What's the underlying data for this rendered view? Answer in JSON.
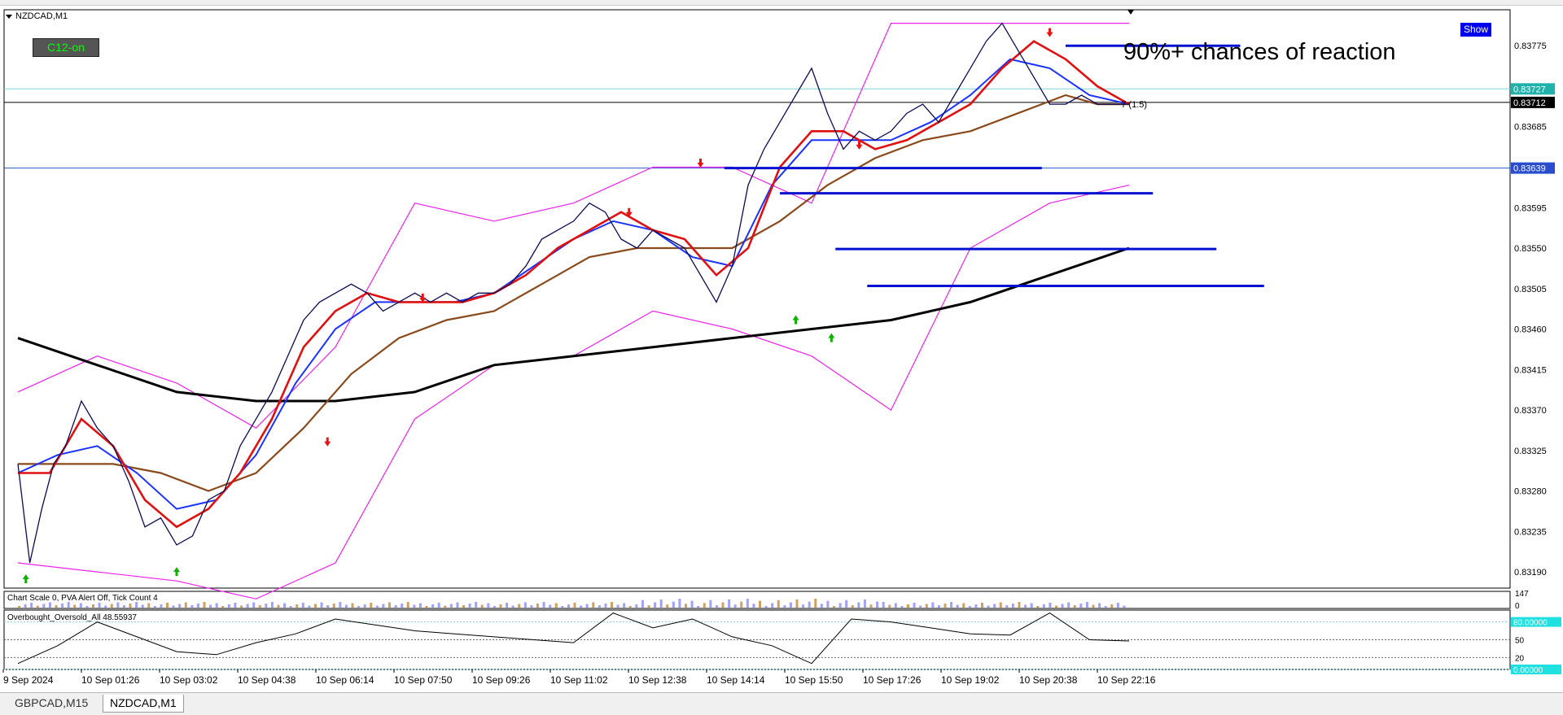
{
  "window": {
    "symbol_title": "NZDCAD,M1",
    "indicator_button": "C12-on",
    "show_button": "Show",
    "annotation": "90%+ chances of reaction",
    "info_line": "Chart Scale  0,   PVA Alert Off,   Tick Count  4",
    "oscillator_label": "Overbought_Oversold_All 48.55937",
    "ratio_label": "7 (1.5)"
  },
  "tabs": [
    {
      "label": "GBPCAD,M15",
      "active": false
    },
    {
      "label": "NZDCAD,M1",
      "active": true
    }
  ],
  "colors": {
    "price": "#0b0b55",
    "ma_red": "#e01010",
    "ma_blue": "#1a33ff",
    "ma_brown": "#8b4a1c",
    "ma_black": "#000000",
    "envelope_pink": "#ee22ee",
    "bands_gray": "#222222",
    "levels_blue": "#0010d0",
    "grid_cyan": "#7fd6d6",
    "tag_cyan": "#20b2aa",
    "signal_green": "#10b000",
    "signal_red": "#ee1111"
  },
  "chart_data": {
    "type": "line",
    "title": "NZDCAD,M1",
    "x_ticks": [
      "9 Sep 2024",
      "10 Sep 01:26",
      "10 Sep 03:02",
      "10 Sep 04:38",
      "10 Sep 06:14",
      "10 Sep 07:50",
      "10 Sep 09:26",
      "10 Sep 11:02",
      "10 Sep 12:38",
      "10 Sep 14:14",
      "10 Sep 15:50",
      "10 Sep 17:26",
      "10 Sep 19:02",
      "10 Sep 20:38",
      "10 Sep 22:16"
    ],
    "y_ticks": [
      0.83775,
      0.83685,
      0.83595,
      0.8355,
      0.83505,
      0.8346,
      0.83415,
      0.8337,
      0.83325,
      0.8328,
      0.83235,
      0.8319
    ],
    "y_tick_labels": [
      "0.83775",
      "0.83685",
      "0.83595",
      "0.83550",
      "0.83505",
      "0.83460",
      "0.83415",
      "0.83370",
      "0.83325",
      "0.83280",
      "0.83235",
      "0.83190"
    ],
    "ylim": [
      0.83172,
      0.83815
    ],
    "xlim": [
      0,
      14
    ],
    "price_tags": [
      {
        "label": "0.83727",
        "value": 0.83727,
        "style": "cyan"
      },
      {
        "label": "0.83712",
        "value": 0.83712,
        "style": "black"
      },
      {
        "label": "0.83639",
        "value": 0.83639,
        "style": "blue"
      }
    ],
    "levels": [
      {
        "x1": 13.2,
        "x2": 15.4,
        "value": 0.83775
      },
      {
        "x1": 8.9,
        "x2": 12.9,
        "value": 0.83639
      },
      {
        "x1": 9.6,
        "x2": 14.3,
        "value": 0.83611
      },
      {
        "x1": 10.3,
        "x2": 15.1,
        "value": 0.83549
      },
      {
        "x1": 10.7,
        "x2": 15.7,
        "value": 0.83508
      }
    ],
    "series": [
      {
        "role": "price",
        "x": [
          0,
          0.15,
          0.3,
          0.45,
          0.6,
          0.8,
          1.0,
          1.2,
          1.4,
          1.6,
          1.8,
          2.0,
          2.2,
          2.4,
          2.6,
          2.8,
          3.0,
          3.2,
          3.4,
          3.6,
          3.8,
          4.0,
          4.2,
          4.4,
          4.6,
          4.8,
          5.0,
          5.2,
          5.4,
          5.6,
          5.8,
          6.0,
          6.2,
          6.4,
          6.6,
          6.8,
          7.0,
          7.2,
          7.4,
          7.6,
          7.8,
          8.0,
          8.2,
          8.4,
          8.6,
          8.8,
          9.0,
          9.2,
          9.4,
          9.6,
          9.8,
          10.0,
          10.2,
          10.4,
          10.6,
          10.8,
          11.0,
          11.2,
          11.4,
          11.6,
          11.8,
          12.0,
          12.2,
          12.4,
          12.6,
          12.8,
          13.0,
          13.2,
          13.4,
          13.6,
          13.8,
          14.0
        ],
        "values": [
          0.8331,
          0.832,
          0.8326,
          0.8331,
          0.8333,
          0.8338,
          0.8335,
          0.8333,
          0.8329,
          0.8324,
          0.8325,
          0.8322,
          0.8323,
          0.8327,
          0.8328,
          0.8333,
          0.8336,
          0.8339,
          0.8343,
          0.8347,
          0.8349,
          0.835,
          0.8351,
          0.835,
          0.8348,
          0.8349,
          0.835,
          0.8349,
          0.835,
          0.8349,
          0.835,
          0.835,
          0.8351,
          0.8353,
          0.8356,
          0.8357,
          0.8358,
          0.836,
          0.8359,
          0.8356,
          0.8355,
          0.8357,
          0.8356,
          0.8355,
          0.8352,
          0.8349,
          0.8353,
          0.8362,
          0.8366,
          0.8369,
          0.8372,
          0.8375,
          0.837,
          0.8366,
          0.8368,
          0.8367,
          0.8368,
          0.837,
          0.8371,
          0.8369,
          0.8372,
          0.8375,
          0.8378,
          0.838,
          0.8377,
          0.8374,
          0.8371,
          0.8371,
          0.8372,
          0.8371,
          0.8371,
          0.8371
        ]
      },
      {
        "role": "ma-red",
        "x": [
          0,
          0.4,
          0.8,
          1.2,
          1.6,
          2.0,
          2.4,
          2.8,
          3.2,
          3.6,
          4.0,
          4.4,
          4.8,
          5.2,
          5.6,
          6.0,
          6.4,
          6.8,
          7.2,
          7.6,
          8.0,
          8.4,
          8.8,
          9.2,
          9.6,
          10.0,
          10.4,
          10.8,
          11.2,
          11.6,
          12.0,
          12.4,
          12.8,
          13.2,
          13.6,
          14.0
        ],
        "values": [
          0.833,
          0.833,
          0.8336,
          0.8333,
          0.8327,
          0.8324,
          0.8326,
          0.833,
          0.8336,
          0.8344,
          0.8348,
          0.835,
          0.8349,
          0.8349,
          0.8349,
          0.835,
          0.8352,
          0.8355,
          0.8357,
          0.8359,
          0.8357,
          0.8356,
          0.8352,
          0.8355,
          0.8364,
          0.8368,
          0.8368,
          0.8366,
          0.8367,
          0.8369,
          0.8371,
          0.8375,
          0.8378,
          0.8376,
          0.8373,
          0.8371
        ]
      },
      {
        "role": "ma-blue",
        "x": [
          0,
          0.5,
          1.0,
          1.5,
          2.0,
          2.5,
          3.0,
          3.5,
          4.0,
          4.5,
          5.0,
          5.5,
          6.0,
          6.5,
          7.0,
          7.5,
          8.0,
          8.5,
          9.0,
          9.5,
          10.0,
          10.5,
          11.0,
          11.5,
          12.0,
          12.5,
          13.0,
          13.5,
          14.0
        ],
        "values": [
          0.833,
          0.8332,
          0.8333,
          0.833,
          0.8326,
          0.8327,
          0.8332,
          0.834,
          0.8346,
          0.8349,
          0.8349,
          0.8349,
          0.835,
          0.8353,
          0.8356,
          0.8358,
          0.8357,
          0.8354,
          0.8353,
          0.8362,
          0.8367,
          0.8367,
          0.8367,
          0.8369,
          0.8372,
          0.8376,
          0.8375,
          0.8372,
          0.8371
        ]
      },
      {
        "role": "ma-brown",
        "x": [
          0,
          0.6,
          1.2,
          1.8,
          2.4,
          3.0,
          3.6,
          4.2,
          4.8,
          5.4,
          6.0,
          6.6,
          7.2,
          7.8,
          8.4,
          9.0,
          9.6,
          10.2,
          10.8,
          11.4,
          12.0,
          12.6,
          13.2,
          13.6,
          14.0
        ],
        "values": [
          0.8331,
          0.8331,
          0.8331,
          0.833,
          0.8328,
          0.833,
          0.8335,
          0.8341,
          0.8345,
          0.8347,
          0.8348,
          0.8351,
          0.8354,
          0.8355,
          0.8355,
          0.8355,
          0.8358,
          0.8362,
          0.8365,
          0.8367,
          0.8368,
          0.837,
          0.8372,
          0.8371,
          0.8371
        ]
      },
      {
        "role": "ma-black",
        "x": [
          0,
          1,
          2,
          3,
          4,
          5,
          6,
          7,
          8,
          9,
          10,
          11,
          12,
          13,
          14
        ],
        "values": [
          0.8345,
          0.8342,
          0.8339,
          0.8338,
          0.8338,
          0.8339,
          0.8342,
          0.8343,
          0.8344,
          0.8345,
          0.8346,
          0.8347,
          0.8349,
          0.8352,
          0.8355
        ]
      },
      {
        "role": "band-pink-upper",
        "x": [
          0,
          1,
          2,
          3,
          4,
          5,
          6,
          7,
          8,
          9,
          10,
          11,
          12,
          13,
          14
        ],
        "values": [
          0.8339,
          0.8343,
          0.834,
          0.8335,
          0.8344,
          0.836,
          0.8358,
          0.836,
          0.8364,
          0.8364,
          0.836,
          0.838,
          0.838,
          0.838,
          0.838
        ]
      },
      {
        "role": "band-pink-lower",
        "x": [
          0,
          1,
          2,
          3,
          4,
          5,
          6,
          7,
          8,
          9,
          10,
          11,
          12,
          13,
          14
        ],
        "values": [
          0.832,
          0.8319,
          0.8318,
          0.8316,
          0.832,
          0.8336,
          0.8342,
          0.8343,
          0.8348,
          0.8346,
          0.8343,
          0.8337,
          0.8355,
          0.836,
          0.8362
        ]
      }
    ],
    "signals": [
      {
        "x": 0.1,
        "value": 0.83182,
        "dir": "up"
      },
      {
        "x": 2.0,
        "value": 0.8319,
        "dir": "up"
      },
      {
        "x": 9.8,
        "value": 0.8347,
        "dir": "up"
      },
      {
        "x": 10.25,
        "value": 0.8345,
        "dir": "up"
      },
      {
        "x": 3.9,
        "value": 0.83335,
        "dir": "down"
      },
      {
        "x": 5.1,
        "value": 0.83495,
        "dir": "down"
      },
      {
        "x": 7.7,
        "value": 0.8359,
        "dir": "down"
      },
      {
        "x": 8.6,
        "value": 0.83645,
        "dir": "down"
      },
      {
        "x": 10.6,
        "value": 0.83665,
        "dir": "down"
      },
      {
        "x": 13.0,
        "value": 0.8379,
        "dir": "down"
      }
    ],
    "volume": {
      "label_top": "147",
      "label_bottom": "0",
      "ylim": [
        0,
        147
      ]
    },
    "oscillator": {
      "ylim": [
        0,
        100
      ],
      "level_labels": [
        "80.00000",
        "50",
        "20",
        "0.00000"
      ],
      "levels": [
        80,
        50,
        20,
        0
      ],
      "x": [
        0,
        0.5,
        1.0,
        1.5,
        2.0,
        2.5,
        3.0,
        3.5,
        4.0,
        4.5,
        5.0,
        5.5,
        6.0,
        6.5,
        7.0,
        7.5,
        8.0,
        8.5,
        9.0,
        9.5,
        10.0,
        10.5,
        11.0,
        11.5,
        12.0,
        12.5,
        13.0,
        13.5,
        14.0
      ],
      "values": [
        10,
        40,
        80,
        55,
        30,
        25,
        45,
        60,
        85,
        75,
        65,
        60,
        55,
        50,
        45,
        95,
        70,
        85,
        55,
        40,
        10,
        85,
        80,
        70,
        60,
        58,
        95,
        50,
        48
      ]
    }
  }
}
